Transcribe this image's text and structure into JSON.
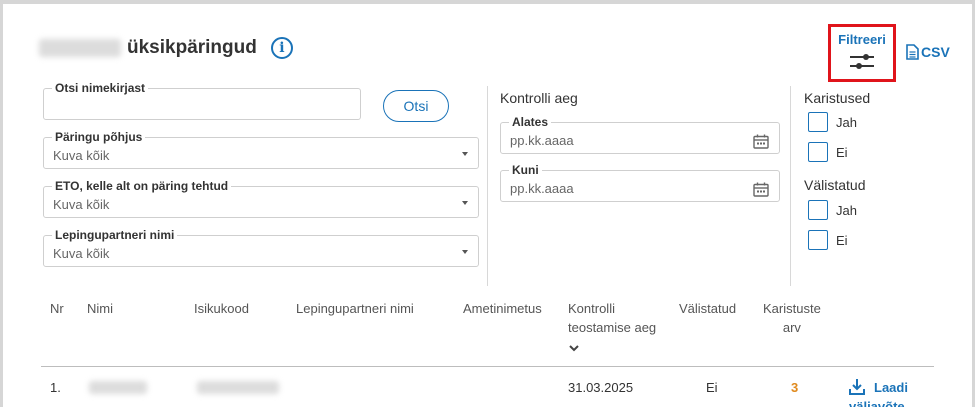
{
  "header": {
    "title": "üksikpäringud",
    "filter_label": "Filtreeri",
    "csv_label": "CSV"
  },
  "search": {
    "legend": "Otsi nimekirjast",
    "value": "",
    "button_label": "Otsi"
  },
  "dropdowns": [
    {
      "legend": "Päringu põhjus",
      "value": "Kuva kõik"
    },
    {
      "legend": "ETO, kelle alt on päring tehtud",
      "value": "Kuva kõik"
    },
    {
      "legend": "Lepingupartneri nimi",
      "value": "Kuva kõik"
    }
  ],
  "control_time": {
    "label": "Kontrolli aeg",
    "from_legend": "Alates",
    "from_placeholder": "pp.kk.aaaa",
    "to_legend": "Kuni",
    "to_placeholder": "pp.kk.aaaa"
  },
  "penalties": {
    "label": "Karistused",
    "options": [
      "Jah",
      "Ei"
    ]
  },
  "excluded": {
    "label": "Välistatud",
    "options": [
      "Jah",
      "Ei"
    ]
  },
  "table": {
    "columns": {
      "nr": "Nr",
      "name": "Nimi",
      "code": "Isikukood",
      "partner": "Lepingupartneri nimi",
      "position": "Ametinimetus",
      "control_line1": "Kontrolli",
      "control_line2": "teostamise aeg",
      "excluded": "Välistatud",
      "penalties_line1": "Karistuste",
      "penalties_line2": "arv"
    },
    "rows": [
      {
        "nr": "1.",
        "date": "31.03.2025",
        "excluded": "Ei",
        "penalties": "3",
        "action_line1": "Laadi",
        "action_line2": "väljavõte"
      }
    ]
  },
  "colors": {
    "accent": "#1a73b8",
    "highlight_border": "#e0141b",
    "penalty_count": "#e08a1e"
  }
}
